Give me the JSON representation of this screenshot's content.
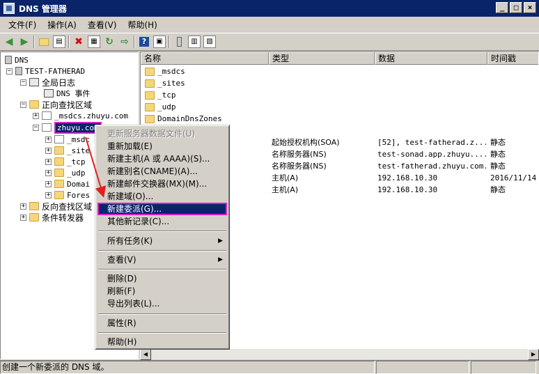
{
  "window": {
    "title": "DNS 管理器",
    "btn_min": "_",
    "btn_max": "□",
    "btn_close": "×"
  },
  "menubar": [
    {
      "label": "文件(F)"
    },
    {
      "label": "操作(A)"
    },
    {
      "label": "查看(V)"
    },
    {
      "label": "帮助(H)"
    }
  ],
  "toolbar": {
    "icons": [
      "back-arrow-icon",
      "forward-arrow-icon",
      "up-folder-icon",
      "show-tree-icon",
      "delete-icon",
      "properties-icon",
      "refresh-icon",
      "export-icon",
      "help-icon",
      "console-icon",
      "server-icon",
      "zone-icon",
      "record-icon"
    ]
  },
  "tree": {
    "root": "DNS",
    "server": "TEST-FATHERAD",
    "global_logs": "全局日志",
    "dns_events": "DNS 事件",
    "forward_zones": "正向查找区域",
    "msdcs_zone": "_msdcs.zhuyu.com",
    "zhuyu_zone": "zhuyu.com",
    "children": [
      "_msdc",
      "_site",
      "_tcp",
      "_udp",
      "Domai",
      "Fores"
    ],
    "reverse_zones": "反向查找区域",
    "conditional_forwarders": "条件转发器"
  },
  "list": {
    "headers": [
      "名称",
      "类型",
      "数据",
      "时间戳"
    ],
    "rows": [
      {
        "name": "_msdcs",
        "type": "",
        "data": "",
        "timestamp": "",
        "icon": "folder-icon"
      },
      {
        "name": "_sites",
        "type": "",
        "data": "",
        "timestamp": "",
        "icon": "folder-icon"
      },
      {
        "name": "_tcp",
        "type": "",
        "data": "",
        "timestamp": "",
        "icon": "folder-icon"
      },
      {
        "name": "_udp",
        "type": "",
        "data": "",
        "timestamp": "",
        "icon": "folder-icon"
      },
      {
        "name": "DomainDnsZones",
        "type": "",
        "data": "",
        "timestamp": "",
        "icon": "folder-icon"
      },
      {
        "name": "",
        "type": "",
        "data": "",
        "timestamp": ""
      },
      {
        "name": "",
        "type": "起始授权机构(SOA)",
        "data": "[52], test-fatherad.z...",
        "timestamp": "静态"
      },
      {
        "name": "",
        "type": "名称服务器(NS)",
        "data": "test-sonad.app.zhuyu....",
        "timestamp": "静态"
      },
      {
        "name": "",
        "type": "名称服务器(NS)",
        "data": "test-fatherad.zhuyu.com.",
        "timestamp": "静态"
      },
      {
        "name": "",
        "type": "主机(A)",
        "data": "192.168.10.30",
        "timestamp": "2016/11/14"
      },
      {
        "name": "",
        "type": "主机(A)",
        "data": "192.168.10.30",
        "timestamp": "静态"
      }
    ]
  },
  "context_menu": {
    "update_server_data": "更新服务器数据文件(U)",
    "reload": "重新加载(E)",
    "new_host": "新建主机(A 或 AAAA)(S)...",
    "new_alias": "新建别名(CNAME)(A)...",
    "new_mx": "新建邮件交换器(MX)(M)...",
    "new_domain": "新建域(O)...",
    "new_delegation": "新建委派(G)...",
    "other_records": "其他新记录(C)...",
    "all_tasks": "所有任务(K)",
    "view": "查看(V)",
    "delete": "删除(D)",
    "refresh": "刷新(F)",
    "export_list": "导出列表(L)...",
    "properties": "属性(R)",
    "help": "帮助(H)",
    "submenu_arrow": "▶"
  },
  "status": {
    "text": "创建一个新委派的 DNS 域。"
  },
  "colors": {
    "highlight": "#0a246a",
    "annotation": "#d81ec8",
    "arrow": "#e02020"
  }
}
